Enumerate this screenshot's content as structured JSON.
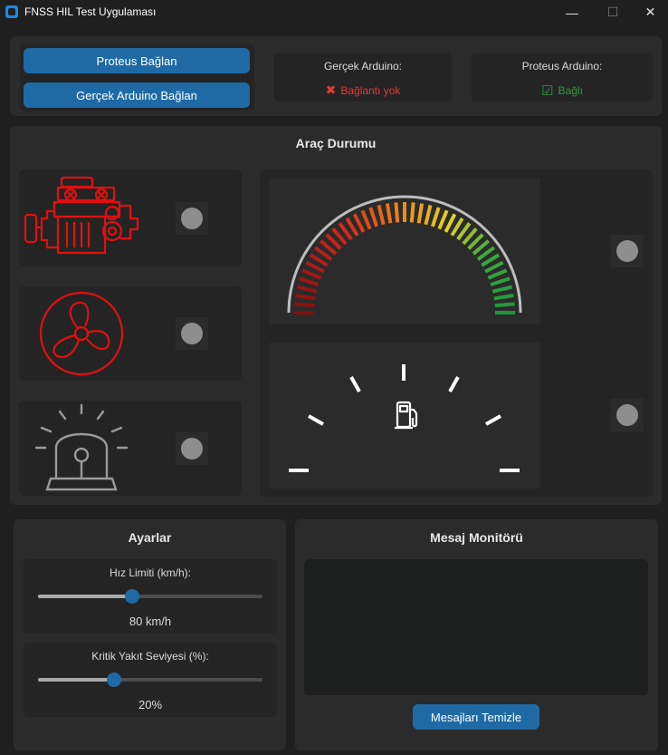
{
  "window": {
    "title": "FNSS HIL Test Uygulaması",
    "minimize": "—",
    "maximize": "☐",
    "close": "✕"
  },
  "connection": {
    "proteus_button": "Proteus Bağlan",
    "real_button": "Gerçek Arduino Bağlan",
    "real_label": "Gerçek Arduino:",
    "real_status": "Bağlantı yok",
    "real_status_icon": "✖",
    "real_status_color": "#e53935",
    "proteus_label": "Proteus Arduino:",
    "proteus_status": "Bağlı",
    "proteus_status_icon": "☑",
    "proteus_status_color": "#2e9e3e"
  },
  "vehicle": {
    "title": "Araç Durumu",
    "indicators": [
      {
        "name": "engine",
        "icon": "engine-icon",
        "color": "#e01010",
        "led": "#8e8e8e"
      },
      {
        "name": "fan",
        "icon": "fan-icon",
        "color": "#e01010",
        "led": "#8e8e8e"
      },
      {
        "name": "alarm",
        "icon": "beacon-light-icon",
        "color": "#9a9a9a",
        "led": "#8e8e8e"
      }
    ],
    "speedometer": {
      "led": "#8e8e8e"
    },
    "fuel": {
      "icon": "fuel-pump-icon",
      "led": "#8e8e8e"
    }
  },
  "settings": {
    "title": "Ayarlar",
    "speed_label": "Hız Limiti (km/h):",
    "speed_value": "80 km/h",
    "speed_fraction": 0.42,
    "fuel_label": "Kritik Yakıt Seviyesi (%):",
    "fuel_value": "20%",
    "fuel_fraction": 0.34
  },
  "monitor": {
    "title": "Mesaj Monitörü",
    "clear_button": "Mesajları Temizle"
  }
}
